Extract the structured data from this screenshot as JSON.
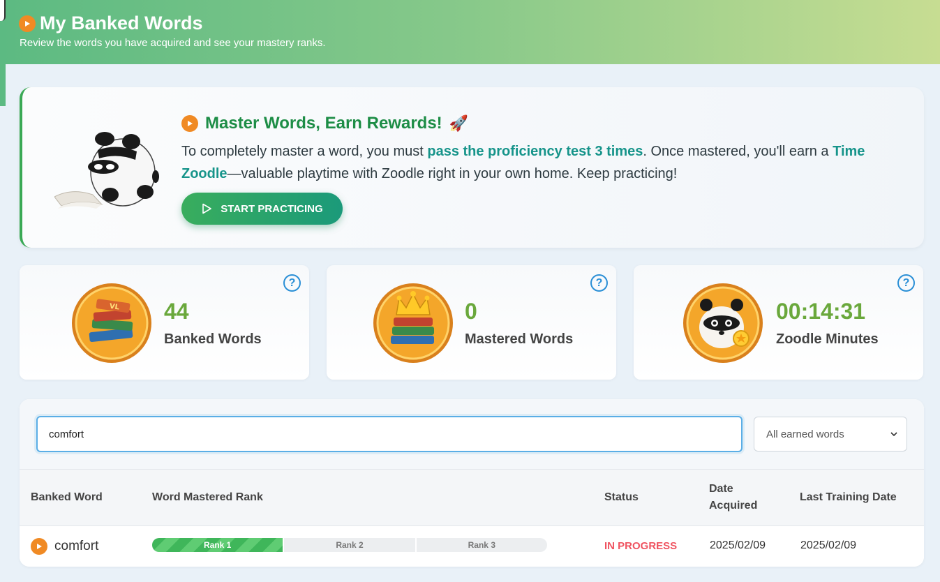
{
  "header": {
    "title": "My Banked Words",
    "subtitle": "Review the words you have acquired and see your mastery ranks."
  },
  "promo": {
    "title": "Master Words, Earn Rewards!",
    "text_before": "To completely master a word, you must ",
    "highlight_1": "pass the proficiency test 3 times",
    "text_middle": ". Once mastered, you'll earn a ",
    "highlight_2": "Time Zoodle",
    "text_after": "—valuable playtime with Zoodle right in your own home. Keep practicing!",
    "button_label": "START PRACTICING"
  },
  "stats": [
    {
      "value": "44",
      "label": "Banked Words",
      "icon": "books-medal-icon"
    },
    {
      "value": "0",
      "label": "Mastered Words",
      "icon": "crown-books-medal-icon"
    },
    {
      "value": "00:14:31",
      "label": "Zoodle Minutes",
      "icon": "panda-medal-icon"
    }
  ],
  "filters": {
    "search_value": "comfort",
    "select_value": "All earned words"
  },
  "table": {
    "columns": [
      "Banked Word",
      "Word Mastered Rank",
      "Status",
      "Date Acquired",
      "Last Training Date"
    ],
    "rows": [
      {
        "word": "comfort",
        "ranks": [
          "Rank 1",
          "Rank 2",
          "Rank 3"
        ],
        "ranks_completed": 1,
        "status": "IN PROGRESS",
        "date_acquired": "2025/02/09",
        "last_training_date": "2025/02/09"
      }
    ]
  },
  "colors": {
    "accent_green": "#1d8d46",
    "stat_value": "#6aa83c",
    "status_in_progress": "#ef5360",
    "play_orange": "#f08a24"
  }
}
